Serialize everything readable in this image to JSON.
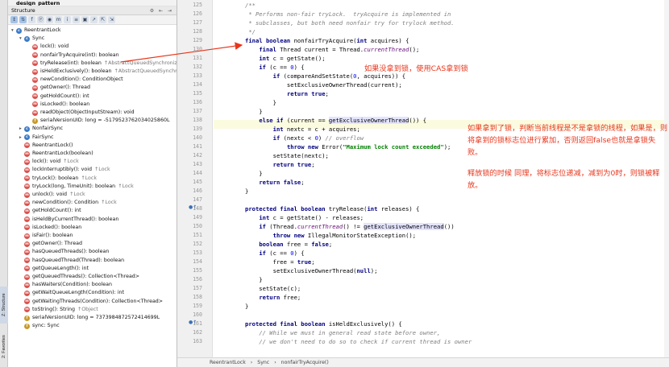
{
  "project": {
    "name": "design_pattern"
  },
  "structure_panel": {
    "title": "Structure",
    "header_icons": "⚙ ⇤ ⇥",
    "toolbar_buttons": [
      "↕",
      "⇅",
      "f",
      "ⓟ",
      "◉",
      "m",
      "i",
      "≡",
      "▣",
      "↗",
      "⇱",
      "⇲"
    ],
    "tree": [
      {
        "depth": 0,
        "icon": "c",
        "arrow": "▾",
        "name": "ReentrantLock",
        "type": ""
      },
      {
        "depth": 1,
        "icon": "c",
        "arrow": "▾",
        "name": "Sync",
        "type": ""
      },
      {
        "depth": 2,
        "icon": "m",
        "arrow": "",
        "name": "lock(): void",
        "type": ""
      },
      {
        "depth": 2,
        "icon": "m",
        "arrow": "",
        "name": "nonfairTryAcquire(int): boolean",
        "type": "",
        "selected": true
      },
      {
        "depth": 2,
        "icon": "m",
        "arrow": "",
        "name": "tryRelease(int): boolean",
        "type": "↑AbstractQueuedSynchronizer"
      },
      {
        "depth": 2,
        "icon": "m",
        "arrow": "",
        "name": "isHeldExclusively(): boolean",
        "type": "↑AbstractQueuedSynchronizer"
      },
      {
        "depth": 2,
        "icon": "m",
        "arrow": "",
        "name": "newCondition(): ConditionObject",
        "type": ""
      },
      {
        "depth": 2,
        "icon": "m",
        "arrow": "",
        "name": "getOwner(): Thread",
        "type": ""
      },
      {
        "depth": 2,
        "icon": "m",
        "arrow": "",
        "name": "getHoldCount(): int",
        "type": ""
      },
      {
        "depth": 2,
        "icon": "m",
        "arrow": "",
        "name": "isLocked(): boolean",
        "type": ""
      },
      {
        "depth": 2,
        "icon": "m",
        "arrow": "",
        "name": "readObject(ObjectInputStream): void",
        "type": ""
      },
      {
        "depth": 2,
        "icon": "f",
        "arrow": "",
        "name": "serialVersionUID: long = -5179523762034025860L",
        "type": ""
      },
      {
        "depth": 1,
        "icon": "c",
        "arrow": "▸",
        "name": "NonfairSync",
        "type": ""
      },
      {
        "depth": 1,
        "icon": "c",
        "arrow": "▸",
        "name": "FairSync",
        "type": ""
      },
      {
        "depth": 1,
        "icon": "m",
        "arrow": "",
        "name": "ReentrantLock()",
        "type": ""
      },
      {
        "depth": 1,
        "icon": "m",
        "arrow": "",
        "name": "ReentrantLock(boolean)",
        "type": ""
      },
      {
        "depth": 1,
        "icon": "m",
        "arrow": "",
        "name": "lock(): void",
        "type": "↑Lock"
      },
      {
        "depth": 1,
        "icon": "m",
        "arrow": "",
        "name": "lockInterruptibly(): void",
        "type": "↑Lock"
      },
      {
        "depth": 1,
        "icon": "m",
        "arrow": "",
        "name": "tryLock(): boolean",
        "type": "↑Lock"
      },
      {
        "depth": 1,
        "icon": "m",
        "arrow": "",
        "name": "tryLock(long, TimeUnit): boolean",
        "type": "↑Lock"
      },
      {
        "depth": 1,
        "icon": "m",
        "arrow": "",
        "name": "unlock(): void",
        "type": "↑Lock"
      },
      {
        "depth": 1,
        "icon": "m",
        "arrow": "",
        "name": "newCondition(): Condition",
        "type": "↑Lock"
      },
      {
        "depth": 1,
        "icon": "m",
        "arrow": "",
        "name": "getHoldCount(): int",
        "type": ""
      },
      {
        "depth": 1,
        "icon": "m",
        "arrow": "",
        "name": "isHeldByCurrentThread(): boolean",
        "type": ""
      },
      {
        "depth": 1,
        "icon": "m",
        "arrow": "",
        "name": "isLocked(): boolean",
        "type": ""
      },
      {
        "depth": 1,
        "icon": "m",
        "arrow": "",
        "name": "isFair(): boolean",
        "type": ""
      },
      {
        "depth": 1,
        "icon": "m",
        "arrow": "",
        "name": "getOwner(): Thread",
        "type": ""
      },
      {
        "depth": 1,
        "icon": "m",
        "arrow": "",
        "name": "hasQueuedThreads(): boolean",
        "type": ""
      },
      {
        "depth": 1,
        "icon": "m",
        "arrow": "",
        "name": "hasQueuedThread(Thread): boolean",
        "type": ""
      },
      {
        "depth": 1,
        "icon": "m",
        "arrow": "",
        "name": "getQueueLength(): int",
        "type": ""
      },
      {
        "depth": 1,
        "icon": "m",
        "arrow": "",
        "name": "getQueuedThreads(): Collection<Thread>",
        "type": ""
      },
      {
        "depth": 1,
        "icon": "m",
        "arrow": "",
        "name": "hasWaiters(Condition): boolean",
        "type": ""
      },
      {
        "depth": 1,
        "icon": "m",
        "arrow": "",
        "name": "getWaitQueueLength(Condition): int",
        "type": ""
      },
      {
        "depth": 1,
        "icon": "m",
        "arrow": "",
        "name": "getWaitingThreads(Condition): Collection<Thread>",
        "type": ""
      },
      {
        "depth": 1,
        "icon": "m",
        "arrow": "",
        "name": "toString(): String",
        "type": "↑Object"
      },
      {
        "depth": 1,
        "icon": "f",
        "arrow": "",
        "name": "serialVersionUID: long = 7373984872572414699L",
        "type": ""
      },
      {
        "depth": 1,
        "icon": "f",
        "arrow": "",
        "name": "sync: Sync",
        "type": ""
      }
    ]
  },
  "side_tabs": {
    "structure": "Z: Structure",
    "favorites": "2: Favorites"
  },
  "editor": {
    "lines": [
      {
        "n": "125",
        "html": "<span class=\"cm\">/**</span>"
      },
      {
        "n": "126",
        "html": "<span class=\"cm\"> * Performs non-fair tryLock.  tryAcquire is implemented in</span>"
      },
      {
        "n": "127",
        "html": "<span class=\"cm\"> * subclasses, but both need nonfair try for trylock method.</span>"
      },
      {
        "n": "128",
        "html": "<span class=\"cm\"> */</span>"
      },
      {
        "n": "129",
        "html": "<span class=\"kw\">final boolean</span> nonfairTryAcquire(<span class=\"kw\">int</span> acquires) {"
      },
      {
        "n": "130",
        "html": "    <span class=\"kw\">final</span> Thread current = Thread.<span class=\"it\">currentThread</span>();"
      },
      {
        "n": "131",
        "html": "    <span class=\"kw\">int</span> c = getState();"
      },
      {
        "n": "132",
        "html": "    <span class=\"kw\">if</span> (c == <span class=\"num\">0</span>) {"
      },
      {
        "n": "133",
        "html": "        <span class=\"kw\">if</span> (compareAndSetState(<span class=\"num\">0</span>, acquires)) {"
      },
      {
        "n": "134",
        "html": "            setExclusiveOwnerThread(current);"
      },
      {
        "n": "135",
        "html": "            <span class=\"kw\">return true</span>;"
      },
      {
        "n": "136",
        "html": "        }"
      },
      {
        "n": "137",
        "html": "    }"
      },
      {
        "n": "138",
        "html": "    <span class=\"kw\">else if</span> (current == <span class=\"hl\">getExclusiveOwnerThread</span>()) {"
      },
      {
        "n": "139",
        "html": "        <span class=\"kw\">int</span> nextc = c + acquires;"
      },
      {
        "n": "140",
        "html": "        <span class=\"kw\">if</span> (nextc &lt; <span class=\"num\">0</span>) <span class=\"cm\">// overflow</span>"
      },
      {
        "n": "141",
        "html": "            <span class=\"kw\">throw new</span> Error(<span class=\"str\">\"Maximum lock count exceeded\"</span>);"
      },
      {
        "n": "142",
        "html": "        setState(nextc);"
      },
      {
        "n": "143",
        "html": "        <span class=\"kw\">return true</span>;"
      },
      {
        "n": "144",
        "html": "    }"
      },
      {
        "n": "145",
        "html": "    <span class=\"kw\">return false</span>;"
      },
      {
        "n": "146",
        "html": "}"
      },
      {
        "n": "147",
        "html": ""
      },
      {
        "n": "148",
        "html": "<span class=\"kw\">protected final boolean</span> tryRelease(<span class=\"kw\">int</span> releases) {"
      },
      {
        "n": "149",
        "html": "    <span class=\"kw\">int</span> c = getState() - releases;"
      },
      {
        "n": "150",
        "html": "    <span class=\"kw\">if</span> (Thread.<span class=\"it\">currentThread</span>() != <span class=\"hl2\">getExclusiveOwnerThread</span>())"
      },
      {
        "n": "151",
        "html": "        <span class=\"kw\">throw new</span> IllegalMonitorStateException();"
      },
      {
        "n": "152",
        "html": "    <span class=\"kw\">boolean</span> free = <span class=\"kw\">false</span>;"
      },
      {
        "n": "153",
        "html": "    <span class=\"kw\">if</span> (c == <span class=\"num\">0</span>) {"
      },
      {
        "n": "154",
        "html": "        free = <span class=\"kw\">true</span>;"
      },
      {
        "n": "155",
        "html": "        setExclusiveOwnerThread(<span class=\"kw\">null</span>);"
      },
      {
        "n": "156",
        "html": "    }"
      },
      {
        "n": "157",
        "html": "    setState(c);"
      },
      {
        "n": "158",
        "html": "    <span class=\"kw\">return</span> free;"
      },
      {
        "n": "159",
        "html": "}"
      },
      {
        "n": "160",
        "html": ""
      },
      {
        "n": "161",
        "html": "<span class=\"kw\">protected final boolean</span> isHeldExclusively() {"
      },
      {
        "n": "162",
        "html": "    <span class=\"cm\">// While we must in general read state before owner,</span>"
      },
      {
        "n": "163",
        "html": "    <span class=\"cm\">// we don't need to do so to check if current thread is owner</span>"
      }
    ]
  },
  "annotations": {
    "cas": "如果没拿到锁，使用CAS拿到锁",
    "reentrant": "如果拿到了锁，判断当前线程是不是拿锁的线程，如果是，则将拿到的锁标志位进行累加，否则返回false也就是拿锁失败。",
    "release": "释放锁的时候 同理，将标志位递减，减到为0时，则锁被释放。"
  },
  "statusbar": {
    "crumbs": [
      "ReentrantLock",
      "›",
      "Sync",
      "›",
      "nonfairTryAcquire()"
    ]
  },
  "colors": {
    "annotation": "#e8361c",
    "keyword": "#000080",
    "comment": "#808080",
    "string": "#008000"
  }
}
